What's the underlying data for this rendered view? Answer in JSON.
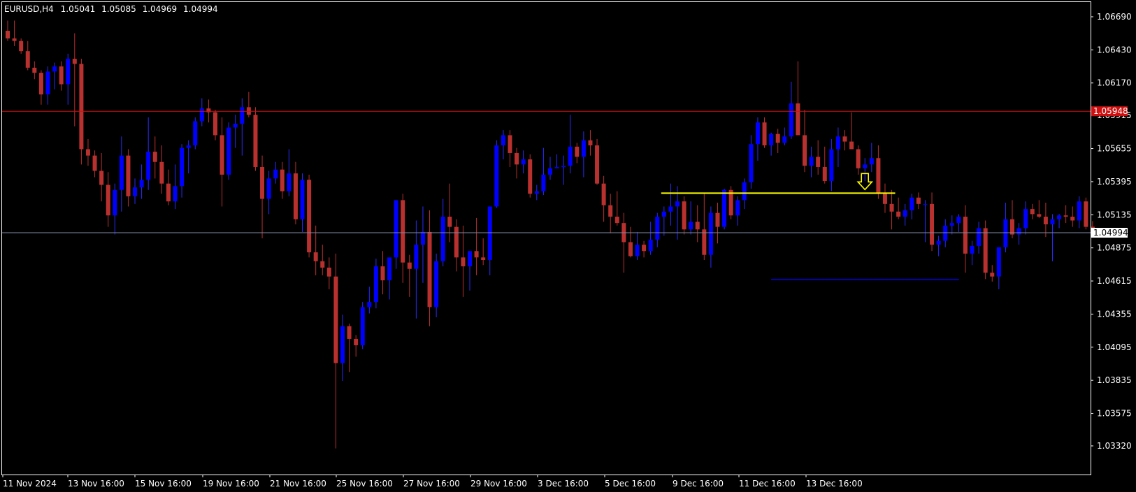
{
  "header": {
    "symbol": "EURUSD,H4",
    "open": "1.05041",
    "high": "1.05085",
    "low": "1.04969",
    "close": "1.04994"
  },
  "colors": {
    "background": "#000000",
    "frame": "#ffffff",
    "bull": "#0000ff",
    "bear": "#b8312f",
    "wick": "#2a2aff",
    "bid_line": "#7f8aa5",
    "red_line": "#d01010",
    "yellow_line": "#ffff00",
    "support_line": "#0000ff",
    "small_green": "#00c000"
  },
  "icons": {
    "arrow": "down-arrow-icon"
  },
  "chart_data": {
    "type": "candlestick",
    "title": "EURUSD,H4",
    "ylim": [
      1.0315,
      1.0685
    ],
    "y_ticks": [
      "1.06690",
      "1.06430",
      "1.06170",
      "1.05915",
      "1.05655",
      "1.05395",
      "1.05135",
      "1.04875",
      "1.04615",
      "1.04355",
      "1.04095",
      "1.03835",
      "1.03575",
      "1.03320"
    ],
    "x_ticks": [
      "11 Nov 2024",
      "13 Nov 16:00",
      "15 Nov 16:00",
      "19 Nov 16:00",
      "21 Nov 16:00",
      "25 Nov 16:00",
      "27 Nov 16:00",
      "29 Nov 16:00",
      "3 Dec 16:00",
      "5 Dec 16:00",
      "9 Dec 16:00",
      "11 Dec 16:00",
      "13 Dec 16:00"
    ],
    "current_price_label": "1.04994",
    "current_price": 1.04994,
    "red_level_label": "1.05948",
    "red_level": 1.05948,
    "yellow_level": 1.05305,
    "yellow_range": [
      98,
      132
    ],
    "support_level": 1.04625,
    "support_range": [
      114,
      141
    ],
    "arrow_index": 128,
    "candles": [
      [
        1.0658,
        1.0666,
        1.065,
        1.0652
      ],
      [
        1.0652,
        1.0666,
        1.0646,
        1.065
      ],
      [
        1.065,
        1.0652,
        1.064,
        1.0642
      ],
      [
        1.0642,
        1.065,
        1.0627,
        1.0629
      ],
      [
        1.0629,
        1.0634,
        1.062,
        1.0625
      ],
      [
        1.0625,
        1.0627,
        1.06,
        1.0608
      ],
      [
        1.0608,
        1.063,
        1.06,
        1.0626
      ],
      [
        1.0626,
        1.0633,
        1.0612,
        1.063
      ],
      [
        1.063,
        1.0634,
        1.0611,
        1.0616
      ],
      [
        1.0616,
        1.064,
        1.06,
        1.0636
      ],
      [
        1.0636,
        1.0656,
        1.0583,
        1.0632
      ],
      [
        1.0632,
        1.0636,
        1.0553,
        1.0565
      ],
      [
        1.0565,
        1.0573,
        1.0552,
        1.056
      ],
      [
        1.056,
        1.0564,
        1.0543,
        1.0548
      ],
      [
        1.0548,
        1.0562,
        1.0524,
        1.0537
      ],
      [
        1.0537,
        1.0547,
        1.0504,
        1.0513
      ],
      [
        1.0513,
        1.0538,
        1.0498,
        1.0533
      ],
      [
        1.0533,
        1.0575,
        1.0516,
        1.056
      ],
      [
        1.056,
        1.0565,
        1.052,
        1.0528
      ],
      [
        1.0528,
        1.0542,
        1.0522,
        1.0535
      ],
      [
        1.0535,
        1.0553,
        1.0526,
        1.0541
      ],
      [
        1.0541,
        1.059,
        1.0533,
        1.0563
      ],
      [
        1.0563,
        1.0575,
        1.0542,
        1.0555
      ],
      [
        1.0555,
        1.0568,
        1.053,
        1.0538
      ],
      [
        1.0538,
        1.0549,
        1.0521,
        1.0524
      ],
      [
        1.0524,
        1.0553,
        1.0518,
        1.0536
      ],
      [
        1.0536,
        1.0569,
        1.0527,
        1.0566
      ],
      [
        1.0566,
        1.0572,
        1.0546,
        1.0568
      ],
      [
        1.0568,
        1.059,
        1.0565,
        1.0587
      ],
      [
        1.0587,
        1.0605,
        1.0583,
        1.0597
      ],
      [
        1.0597,
        1.0604,
        1.0586,
        1.0594
      ],
      [
        1.0594,
        1.0596,
        1.0572,
        1.0576
      ],
      [
        1.0576,
        1.059,
        1.052,
        1.0545
      ],
      [
        1.0545,
        1.0586,
        1.0541,
        1.0582
      ],
      [
        1.0582,
        1.0592,
        1.0566,
        1.0585
      ],
      [
        1.0585,
        1.0605,
        1.056,
        1.0598
      ],
      [
        1.0598,
        1.061,
        1.059,
        1.0592
      ],
      [
        1.0592,
        1.0598,
        1.0548,
        1.0551
      ],
      [
        1.0551,
        1.056,
        1.0495,
        1.0526
      ],
      [
        1.0526,
        1.0548,
        1.0514,
        1.0542
      ],
      [
        1.0542,
        1.0555,
        1.0538,
        1.0549
      ],
      [
        1.0549,
        1.0555,
        1.0526,
        1.0532
      ],
      [
        1.0532,
        1.0565,
        1.0528,
        1.0546
      ],
      [
        1.0546,
        1.0555,
        1.0506,
        1.051
      ],
      [
        1.051,
        1.0546,
        1.05,
        1.0541
      ],
      [
        1.0541,
        1.0545,
        1.048,
        1.0484
      ],
      [
        1.0484,
        1.0505,
        1.0466,
        1.0477
      ],
      [
        1.0477,
        1.049,
        1.0466,
        1.0472
      ],
      [
        1.0472,
        1.048,
        1.0455,
        1.0465
      ],
      [
        1.0465,
        1.0483,
        1.033,
        1.0397
      ],
      [
        1.0397,
        1.0435,
        1.0383,
        1.0426
      ],
      [
        1.0426,
        1.0428,
        1.039,
        1.0416
      ],
      [
        1.0416,
        1.0419,
        1.0402,
        1.0411
      ],
      [
        1.0411,
        1.0445,
        1.0408,
        1.0441
      ],
      [
        1.0441,
        1.0457,
        1.0436,
        1.0445
      ],
      [
        1.0445,
        1.0479,
        1.044,
        1.0473
      ],
      [
        1.0473,
        1.0485,
        1.0451,
        1.0462
      ],
      [
        1.0462,
        1.0469,
        1.0447,
        1.048
      ],
      [
        1.048,
        1.051,
        1.0471,
        1.0525
      ],
      [
        1.0525,
        1.053,
        1.046,
        1.0476
      ],
      [
        1.0476,
        1.0482,
        1.0449,
        1.0471
      ],
      [
        1.0471,
        1.0509,
        1.0432,
        1.049
      ],
      [
        1.049,
        1.052,
        1.046,
        1.05
      ],
      [
        1.05,
        1.0517,
        1.0426,
        1.0441
      ],
      [
        1.0441,
        1.0483,
        1.0433,
        1.0477
      ],
      [
        1.0477,
        1.0526,
        1.0473,
        1.0512
      ],
      [
        1.0512,
        1.0538,
        1.0492,
        1.0504
      ],
      [
        1.0504,
        1.051,
        1.0469,
        1.048
      ],
      [
        1.048,
        1.0505,
        1.0449,
        1.0473
      ],
      [
        1.0473,
        1.0485,
        1.0454,
        1.0485
      ],
      [
        1.0485,
        1.0511,
        1.0466,
        1.048
      ],
      [
        1.048,
        1.0495,
        1.0474,
        1.0478
      ],
      [
        1.0478,
        1.0516,
        1.0466,
        1.052
      ],
      [
        1.052,
        1.0572,
        1.0519,
        1.0568
      ],
      [
        1.0568,
        1.058,
        1.0557,
        1.0576
      ],
      [
        1.0576,
        1.058,
        1.0551,
        1.0562
      ],
      [
        1.0562,
        1.0566,
        1.0542,
        1.0553
      ],
      [
        1.0553,
        1.0564,
        1.0546,
        1.0557
      ],
      [
        1.0557,
        1.0561,
        1.0527,
        1.053
      ],
      [
        1.053,
        1.0537,
        1.0525,
        1.0532
      ],
      [
        1.0532,
        1.0566,
        1.0529,
        1.0545
      ],
      [
        1.0545,
        1.0559,
        1.0541,
        1.055
      ],
      [
        1.055,
        1.0561,
        1.055,
        1.0551
      ],
      [
        1.0551,
        1.056,
        1.0537,
        1.0552
      ],
      [
        1.0552,
        1.0592,
        1.0546,
        1.0567
      ],
      [
        1.0567,
        1.057,
        1.0554,
        1.0559
      ],
      [
        1.0559,
        1.0579,
        1.0543,
        1.0572
      ],
      [
        1.0572,
        1.058,
        1.056,
        1.0568
      ],
      [
        1.0568,
        1.0573,
        1.0537,
        1.0538
      ],
      [
        1.0538,
        1.0544,
        1.0508,
        1.0521
      ],
      [
        1.0521,
        1.053,
        1.0499,
        1.0512
      ],
      [
        1.0512,
        1.0532,
        1.0505,
        1.0507
      ],
      [
        1.0507,
        1.0515,
        1.0468,
        1.0492
      ],
      [
        1.0492,
        1.0504,
        1.048,
        1.0481
      ],
      [
        1.0481,
        1.05,
        1.0478,
        1.049
      ],
      [
        1.049,
        1.0493,
        1.048,
        1.0485
      ],
      [
        1.0485,
        1.0508,
        1.0482,
        1.0494
      ],
      [
        1.0494,
        1.0515,
        1.0488,
        1.0512
      ],
      [
        1.0512,
        1.052,
        1.0497,
        1.0516
      ],
      [
        1.0516,
        1.0538,
        1.0505,
        1.052
      ],
      [
        1.052,
        1.0536,
        1.0494,
        1.0524
      ],
      [
        1.0524,
        1.0528,
        1.0498,
        1.0502
      ],
      [
        1.0502,
        1.0524,
        1.0498,
        1.0508
      ],
      [
        1.0508,
        1.0521,
        1.0492,
        1.0502
      ],
      [
        1.0502,
        1.053,
        1.0478,
        1.0482
      ],
      [
        1.0482,
        1.052,
        1.0472,
        1.0515
      ],
      [
        1.0515,
        1.0523,
        1.0491,
        1.0504
      ],
      [
        1.0504,
        1.0534,
        1.0502,
        1.0533
      ],
      [
        1.0533,
        1.0536,
        1.051,
        1.0513
      ],
      [
        1.0513,
        1.0528,
        1.0505,
        1.0525
      ],
      [
        1.0525,
        1.0542,
        1.0518,
        1.0539
      ],
      [
        1.0539,
        1.0576,
        1.0534,
        1.0569
      ],
      [
        1.0569,
        1.059,
        1.0556,
        1.0586
      ],
      [
        1.0586,
        1.059,
        1.0566,
        1.0568
      ],
      [
        1.0568,
        1.0578,
        1.056,
        1.0577
      ],
      [
        1.0577,
        1.0581,
        1.0562,
        1.057
      ],
      [
        1.057,
        1.0582,
        1.0568,
        1.0575
      ],
      [
        1.0575,
        1.0618,
        1.0573,
        1.0601
      ],
      [
        1.0601,
        1.0634,
        1.0584,
        1.0576
      ],
      [
        1.0576,
        1.0596,
        1.0547,
        1.0552
      ],
      [
        1.0552,
        1.0567,
        1.0543,
        1.0559
      ],
      [
        1.0559,
        1.0572,
        1.0545,
        1.0551
      ],
      [
        1.0551,
        1.0567,
        1.0538,
        1.054
      ],
      [
        1.054,
        1.0573,
        1.0532,
        1.0565
      ],
      [
        1.0565,
        1.0582,
        1.0551,
        1.0575
      ],
      [
        1.0575,
        1.058,
        1.0564,
        1.0571
      ],
      [
        1.0571,
        1.0594,
        1.0567,
        1.0565
      ],
      [
        1.0565,
        1.0568,
        1.0545,
        1.055
      ],
      [
        1.055,
        1.0558,
        1.054,
        1.0553
      ],
      [
        1.0553,
        1.057,
        1.0547,
        1.0558
      ],
      [
        1.0558,
        1.0568,
        1.0526,
        1.053
      ],
      [
        1.053,
        1.0538,
        1.0515,
        1.0522
      ],
      [
        1.0522,
        1.0533,
        1.0502,
        1.0516
      ],
      [
        1.0516,
        1.0527,
        1.051,
        1.0512
      ],
      [
        1.0512,
        1.0522,
        1.0505,
        1.0517
      ],
      [
        1.0517,
        1.053,
        1.051,
        1.0527
      ],
      [
        1.0527,
        1.0531,
        1.0518,
        1.0522
      ],
      [
        1.0522,
        1.0525,
        1.0492,
        1.0522
      ],
      [
        1.0522,
        1.0531,
        1.0485,
        1.049
      ],
      [
        1.049,
        1.0497,
        1.0481,
        1.0493
      ],
      [
        1.0493,
        1.051,
        1.0488,
        1.0505
      ],
      [
        1.0505,
        1.0513,
        1.0498,
        1.0507
      ],
      [
        1.0507,
        1.0514,
        1.05,
        1.0512
      ],
      [
        1.0512,
        1.0521,
        1.0468,
        1.0483
      ],
      [
        1.0483,
        1.0493,
        1.0474,
        1.0489
      ],
      [
        1.0489,
        1.0508,
        1.0483,
        1.0503
      ],
      [
        1.0503,
        1.0509,
        1.0463,
        1.0468
      ],
      [
        1.0468,
        1.0474,
        1.0461,
        1.0465
      ],
      [
        1.0465,
        1.0478,
        1.0455,
        1.0488
      ],
      [
        1.0488,
        1.0523,
        1.0484,
        1.051
      ],
      [
        1.051,
        1.0525,
        1.0495,
        1.0498
      ],
      [
        1.0498,
        1.0507,
        1.049,
        1.0503
      ],
      [
        1.0503,
        1.0524,
        1.0498,
        1.0518
      ],
      [
        1.0518,
        1.0522,
        1.051,
        1.0514
      ],
      [
        1.0514,
        1.0525,
        1.0511,
        1.0512
      ],
      [
        1.0512,
        1.0523,
        1.0496,
        1.0506
      ],
      [
        1.0506,
        1.0514,
        1.0477,
        1.051
      ],
      [
        1.051,
        1.0514,
        1.0503,
        1.0513
      ],
      [
        1.0513,
        1.0521,
        1.0507,
        1.0512
      ],
      [
        1.0512,
        1.052,
        1.0504,
        1.0509
      ],
      [
        1.0509,
        1.0528,
        1.0503,
        1.0524
      ],
      [
        1.0524,
        1.0527,
        1.0502,
        1.0504
      ],
      [
        1.05041,
        1.05085,
        1.04969,
        1.04994
      ]
    ]
  }
}
